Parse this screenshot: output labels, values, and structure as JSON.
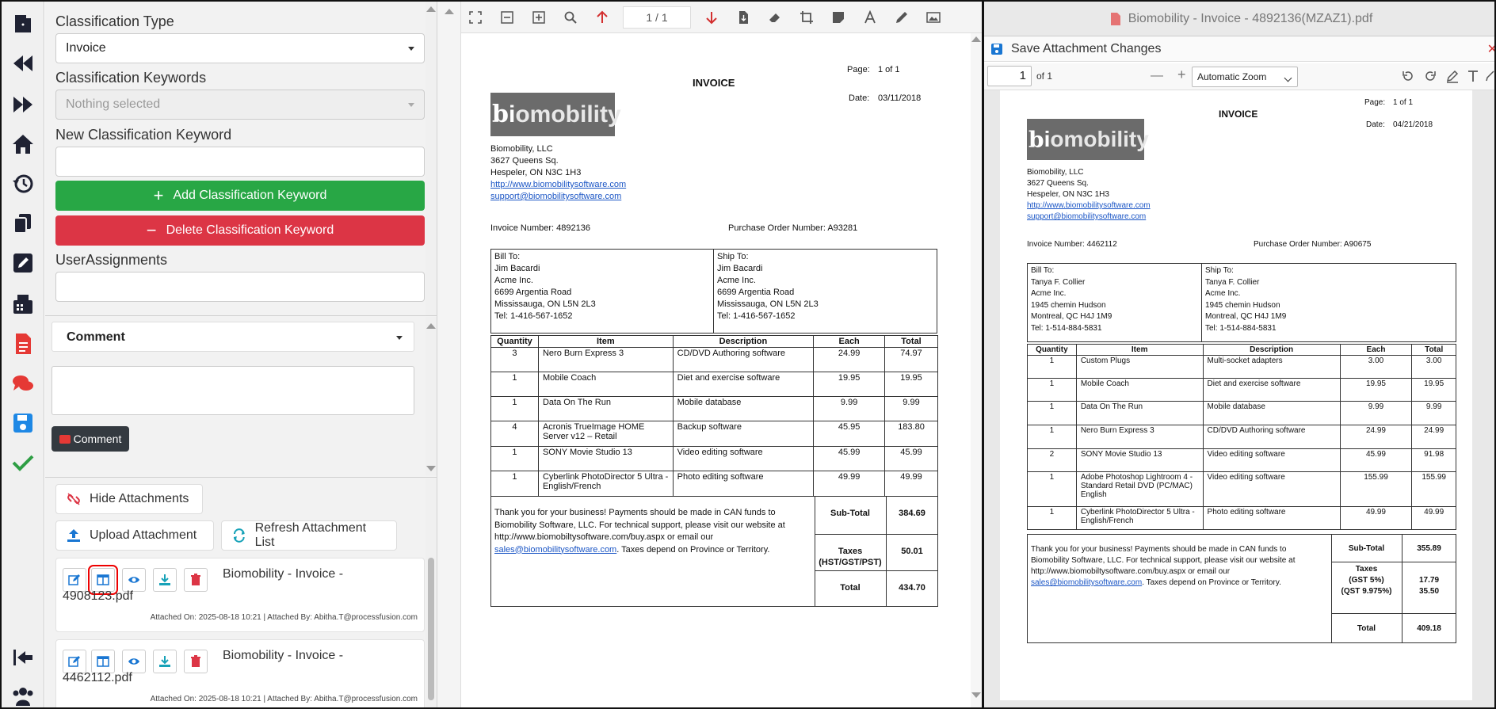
{
  "form": {
    "classification_type_label": "Classification Type",
    "classification_type_value": "Invoice",
    "keywords_label": "Classification Keywords",
    "keywords_placeholder": "Nothing selected",
    "new_keyword_label": "New Classification Keyword",
    "add_keyword_btn": "Add Classification Keyword",
    "delete_keyword_btn": "Delete Classification Keyword",
    "user_assignments_label": "UserAssignments"
  },
  "comment": {
    "header": "Comment",
    "button": "Comment"
  },
  "attachments": {
    "hide_btn": "Hide Attachments",
    "upload_btn": "Upload Attachment",
    "refresh_btn": "Refresh Attachment List",
    "items": [
      {
        "name_line1": "Biomobility - Invoice -",
        "name_line2": "4908123.pdf",
        "meta": "Attached On: 2025-08-18 10:21 | Attached By: Abitha.T@processfusion.com"
      },
      {
        "name_line1": "Biomobility - Invoice -",
        "name_line2": "4462112.pdf",
        "meta": "Attached On: 2025-08-18 10:21 | Attached By: Abitha.T@processfusion.com"
      }
    ]
  },
  "viewer1": {
    "page_indicator": "1 / 1"
  },
  "viewer2": {
    "title": "Biomobility - Invoice - 4892136(MZAZ1).pdf",
    "save_label": "Save Attachment Changes",
    "page_value": "1",
    "page_of": "of 1",
    "zoom": "Automatic Zoom"
  },
  "invoice1": {
    "title": "INVOICE",
    "page_label": "Page:",
    "page_value": "1 of 1",
    "date_label": "Date:",
    "date_value": "03/11/2018",
    "logo_b": "b",
    "logo_i": "i",
    "logo_text": "omobility",
    "company": [
      "Biomobility, LLC",
      "3627 Queens Sq.",
      "Hespeler, ON N3C 1H3"
    ],
    "web": "http://www.biomobilitysoftware.com",
    "email": "support@biomobilitysoftware.com",
    "invoice_number": "Invoice Number: 4892136",
    "po_number": "Purchase Order Number: A93281",
    "bill_to": [
      "Bill To:",
      "Jim Bacardi",
      "Acme Inc.",
      "6699 Argentia Road",
      "Mississauga, ON L5N 2L3",
      "Tel: 1-416-567-1652"
    ],
    "ship_to": [
      "Ship To:",
      "Jim Bacardi",
      "Acme Inc.",
      "6699 Argentia Road",
      "Mississauga, ON L5N 2L3",
      "Tel: 1-416-567-1652"
    ],
    "headers": [
      "Quantity",
      "Item",
      "Description",
      "Each",
      "Total"
    ],
    "rows": [
      [
        "3",
        "Nero Burn Express 3",
        "CD/DVD Authoring software",
        "24.99",
        "74.97"
      ],
      [
        "1",
        "Mobile Coach",
        "Diet and exercise software",
        "19.95",
        "19.95"
      ],
      [
        "1",
        "Data On The Run",
        "Mobile database",
        "9.99",
        "9.99"
      ],
      [
        "4",
        "Acronis TrueImage HOME Server v12 – Retail",
        "Backup software",
        "45.95",
        "183.80"
      ],
      [
        "1",
        "SONY Movie Studio 13",
        "Video editing software",
        "45.99",
        "45.99"
      ],
      [
        "1",
        "Cyberlink PhotoDirector 5 Ultra - English/French",
        "Photo editing software",
        "49.99",
        "49.99"
      ]
    ],
    "thanks_1": "Thank you for your business! Payments should be made in CAN funds to",
    "thanks_2": "Biomobility Software, LLC. For technical support, please visit our website at",
    "thanks_3": "http://www.biomobiltysoftware.com/buy.aspx or email our",
    "thanks_email": "sales@biomobilitysoftware.com",
    "thanks_4": ". Taxes depend on Province or Territory.",
    "subtotal_label": "Sub-Total",
    "subtotal": "384.69",
    "taxes_label_1": "Taxes",
    "taxes_label_2": "(HST/GST/PST)",
    "taxes": "50.01",
    "total_label": "Total",
    "total": "434.70"
  },
  "invoice2": {
    "title": "INVOICE",
    "page_label": "Page:",
    "page_value": "1 of 1",
    "date_label": "Date:",
    "date_value": "04/21/2018",
    "logo_b": "b",
    "logo_i": "i",
    "logo_text": "omobility",
    "company": [
      "Biomobility, LLC",
      "3627 Queens Sq.",
      "Hespeler, ON N3C 1H3"
    ],
    "web": "http://www.biomobilitysoftware.com",
    "email": "support@biomobilitysoftware.com",
    "invoice_number": "Invoice Number: 4462112",
    "po_number": "Purchase Order Number: A90675",
    "bill_to": [
      "Bill To:",
      "Tanya F. Collier",
      "Acme Inc.",
      "1945 chemin Hudson",
      "Montreal, QC H4J 1M9",
      "Tel: 1-514-884-5831"
    ],
    "ship_to": [
      "Ship To:",
      "Tanya F. Collier",
      "Acme Inc.",
      "1945 chemin Hudson",
      "Montreal, QC H4J 1M9",
      "Tel: 1-514-884-5831"
    ],
    "headers": [
      "Quantity",
      "Item",
      "Description",
      "Each",
      "Total"
    ],
    "rows": [
      [
        "1",
        "Custom Plugs",
        "Multi-socket adapters",
        "3.00",
        "3.00"
      ],
      [
        "1",
        "Mobile Coach",
        "Diet and exercise software",
        "19.95",
        "19.95"
      ],
      [
        "1",
        "Data On The Run",
        "Mobile database",
        "9.99",
        "9.99"
      ],
      [
        "1",
        "Nero Burn Express 3",
        "CD/DVD Authoring software",
        "24.99",
        "24.99"
      ],
      [
        "2",
        "SONY Movie Studio 13",
        "Video editing software",
        "45.99",
        "91.98"
      ],
      [
        "1",
        "Adobe Photoshop Lightroom 4 - Standard Retail DVD (PC/MAC) English",
        "Video editing software",
        "155.99",
        "155.99"
      ],
      [
        "1",
        "Cyberlink PhotoDirector 5 Ultra - English/French",
        "Photo editing software",
        "49.99",
        "49.99"
      ]
    ],
    "thanks_1": "Thank you for your business! Payments should be made in CAN funds to",
    "thanks_2": "Biomobility Software, LLC. For technical support, please visit our website at",
    "thanks_3": "http://www.biomobiltysoftware.com/buy.aspx or email our",
    "thanks_email": "sales@biomobilitysoftware.com",
    "thanks_4": ". Taxes depend on Province or Territory.",
    "subtotal_label": "Sub-Total",
    "subtotal": "355.89",
    "taxes_label_1": "Taxes",
    "taxes_label_2": "(GST 5%)",
    "taxes_label_3": "(QST 9.975%)",
    "taxes_1": "17.79",
    "taxes_2": "35.50",
    "total_label": "Total",
    "total": "409.18"
  },
  "colors": {
    "sidebar_icon": "#1a1a2e",
    "green": "#28a745",
    "red": "#dc3545",
    "blue": "#1976d2",
    "teal": "#17a2b8"
  }
}
